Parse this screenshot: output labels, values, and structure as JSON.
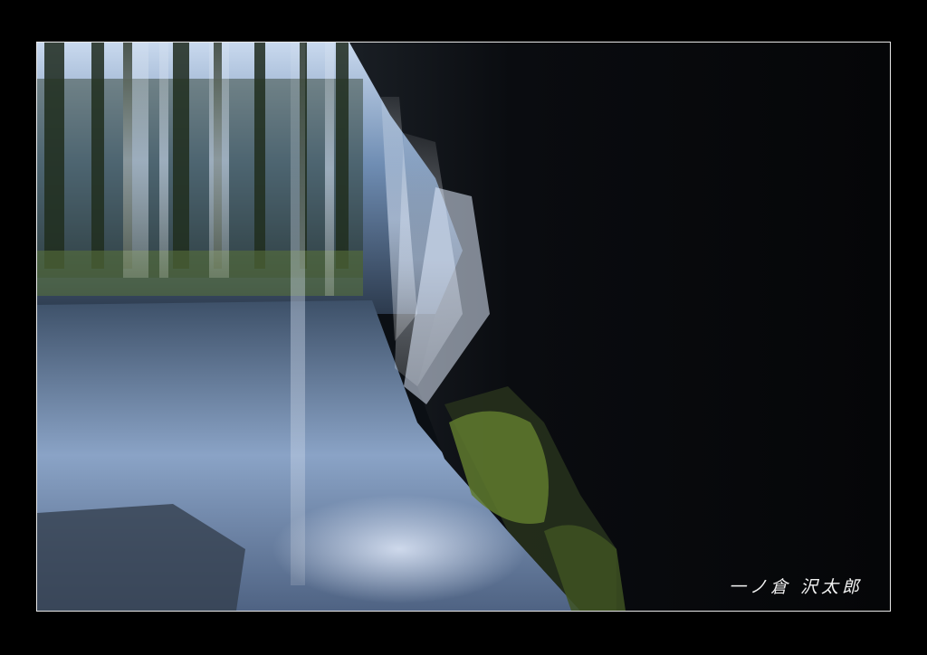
{
  "photo": {
    "signature": "一ノ倉 沢太郎",
    "colors": {
      "frame": "#000000",
      "border": "#e8e8e8",
      "water": "#7f9cc4",
      "cave": "#07090c",
      "moss": "#5f7a2e"
    }
  }
}
